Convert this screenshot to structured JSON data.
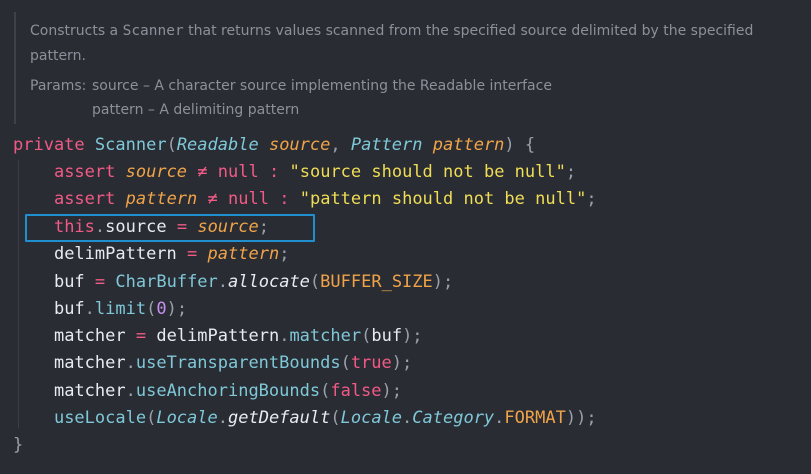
{
  "doc": {
    "line1_prefix": "Constructs a ",
    "line1_code": "Scanner",
    "line1_suffix": " that returns values scanned from the specified source delimited by the specified",
    "line2": "pattern.",
    "params_label": "Params:",
    "param1": "source – A character source implementing the Readable interface",
    "param2": "pattern – A delimiting pattern"
  },
  "code": {
    "kw_private": "private",
    "ctor_name": "Scanner",
    "type_readable": "Readable",
    "p_source": "source",
    "type_pattern": "Pattern",
    "p_pattern": "pattern",
    "kw_assert": "assert",
    "op_neq": "≠",
    "kw_null": "null",
    "str_source": "\"source should not be null\"",
    "str_pattern": "\"pattern should not be null\"",
    "kw_this": "this",
    "field_source": "source",
    "field_delim": "delimPattern",
    "field_buf": "buf",
    "cls_charbuffer": "CharBuffer",
    "m_allocate": "allocate",
    "const_buffer_size": "BUFFER_SIZE",
    "m_limit": "limit",
    "num_zero": "0",
    "field_matcher": "matcher",
    "m_matcher": "matcher",
    "m_use_transparent": "useTransparentBounds",
    "lit_true": "true",
    "m_use_anchoring": "useAnchoringBounds",
    "lit_false": "false",
    "m_use_locale": "useLocale",
    "cls_locale": "Locale",
    "m_get_default": "getDefault",
    "cls_category": "Category",
    "const_format": "FORMAT"
  },
  "colors": {
    "background": "#292c33",
    "keyword": "#f25a85",
    "type": "#7fc8d8",
    "parameter": "#f0a348",
    "string": "#f0dd55",
    "number": "#c78ff0",
    "selection_box": "#1f8fd0"
  }
}
